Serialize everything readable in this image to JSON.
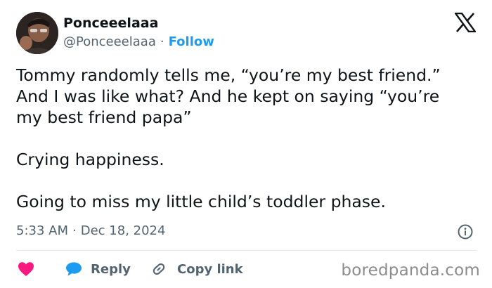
{
  "header": {
    "display_name": "Ponceeelaaa",
    "handle": "@Ponceeelaaa",
    "separator": "·",
    "follow_label": "Follow"
  },
  "tweet": {
    "text": "Tommy randomly tells me, “you’re my best friend.”\nAnd I was like what? And he kept on saying “you’re\nmy best friend papa”\n\nCrying happiness.\n\nGoing to miss my little child’s toddler phase."
  },
  "meta": {
    "time": "5:33 AM",
    "separator": "·",
    "date": "Dec 18, 2024"
  },
  "actions": {
    "reply_label": "Reply",
    "copy_link_label": "Copy link"
  },
  "watermark": {
    "text": "boredpanda.com"
  },
  "colors": {
    "link_blue": "#1d9bf0",
    "like_pink": "#f91880",
    "secondary_text": "#536471",
    "primary_text": "#0f1419"
  },
  "icons": {
    "brand": "x-logo-icon",
    "info": "info-icon",
    "like": "heart-icon",
    "reply": "speech-bubble-icon",
    "copy_link": "link-icon"
  }
}
